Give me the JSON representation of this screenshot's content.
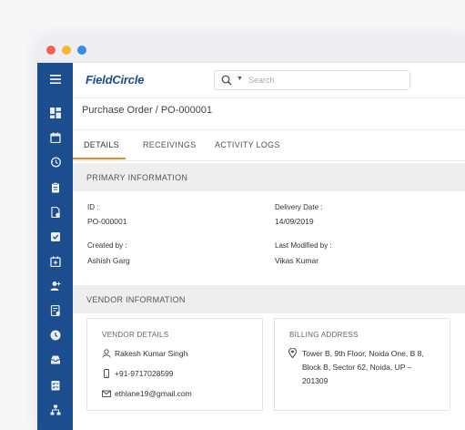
{
  "app": {
    "logo_text": "FieldCircle",
    "search_placeholder": "Search"
  },
  "breadcrumb": "Purchase Order / PO-000001",
  "tabs": [
    {
      "label": "DETAILS",
      "active": true
    },
    {
      "label": "RECEIVINGS",
      "active": false
    },
    {
      "label": "ACTIVITY LOGS",
      "active": false
    }
  ],
  "primary": {
    "header": "PRIMARY INFORMATION",
    "id_label": "ID :",
    "id_value": "PO-000001",
    "delivery_label": "Delivery Date :",
    "delivery_value": "14/09/2019",
    "created_label": "Created by :",
    "created_value": "Ashish Garg",
    "modified_label": "Last Modified by :",
    "modified_value": "Vikas Kumar"
  },
  "vendor": {
    "header": "VENDOR INFORMATION",
    "details_title": "VENDOR DETAILS",
    "name": "Rakesh Kumar Singh",
    "phone": "+91-9717028599",
    "email": "ethlane19@gmail.com",
    "billing_title": "BILLING ADDRESS",
    "address": "Tower B, 9th Floor, Noida One, B 8, Block B, Sector 62, Noida, UP – 201309"
  },
  "sidebar_icons": [
    "menu-icon",
    "dashboard-icon",
    "calendar-icon",
    "history-icon",
    "clipboard-icon",
    "document-settings-icon",
    "checkbox-icon",
    "calendar-plus-icon",
    "user-add-icon",
    "report-icon",
    "clock-icon",
    "inbox-icon",
    "checklist-icon",
    "hierarchy-icon"
  ],
  "colors": {
    "sidebar": "#1c4e8f",
    "accent": "#e8892b",
    "logo_blue": "#1c4e8f"
  }
}
